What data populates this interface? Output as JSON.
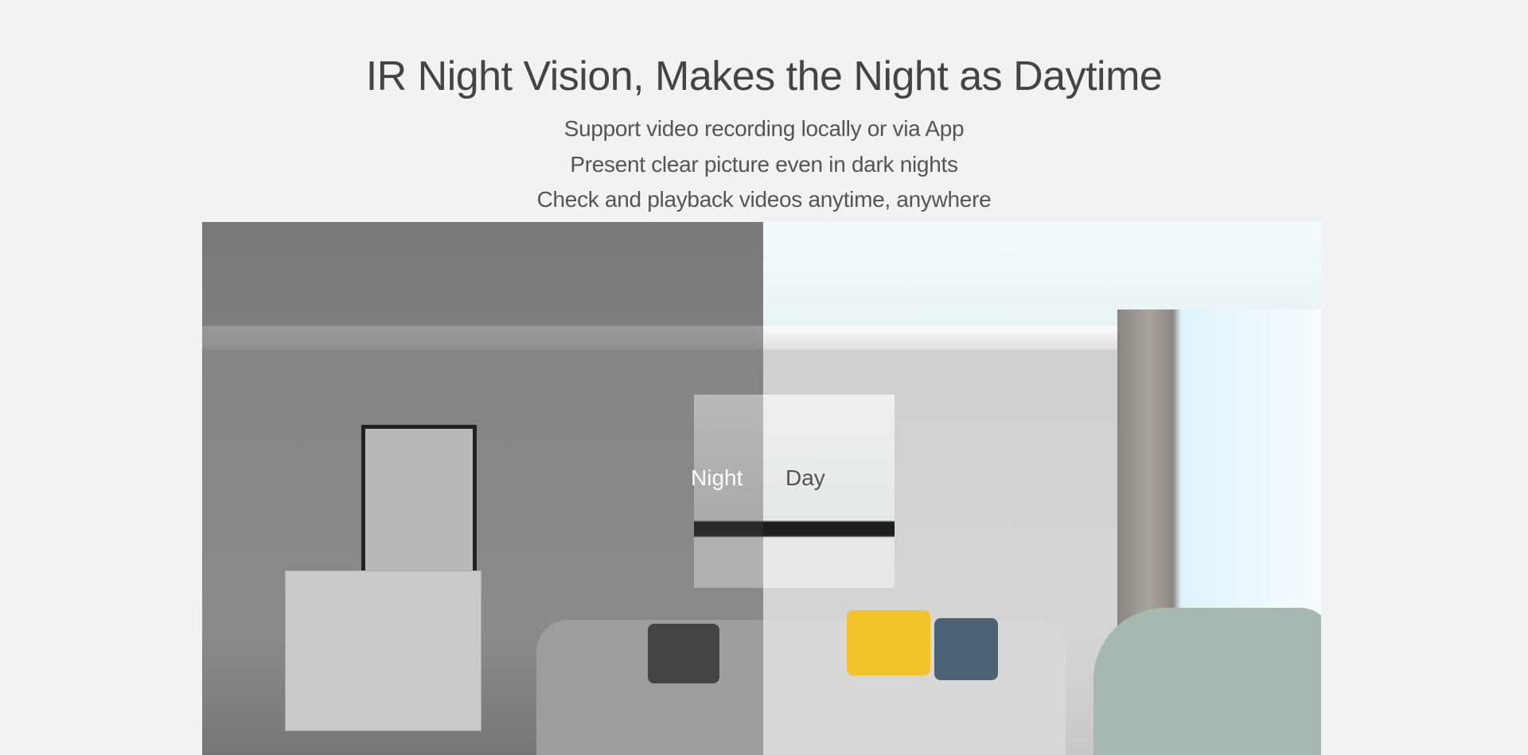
{
  "header": {
    "title": "IR Night Vision, Makes the Night as Daytime",
    "lines": [
      "Support video recording locally or via App",
      "Present clear picture even in dark nights",
      "Check and playback videos anytime, anywhere"
    ]
  },
  "comparison": {
    "night_label": "Night",
    "day_label": "Day"
  }
}
